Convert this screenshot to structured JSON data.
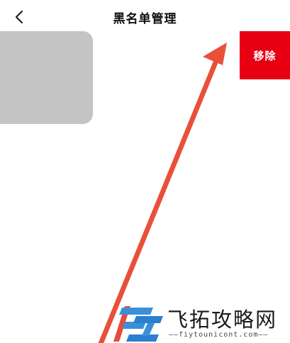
{
  "header": {
    "title": "黑名单管理",
    "back_icon": "chevron-left-icon"
  },
  "blocked_user": {
    "avatar": "avatar-placeholder",
    "remove_label": "移除"
  },
  "annotation": {
    "icon": "arrow-icon",
    "color": "#e8503a"
  },
  "watermark": {
    "name": "飞拓攻略网",
    "domain": "——fiytounicont.com——"
  },
  "colors": {
    "remove_button": "#e60012",
    "avatar_placeholder": "#c4c4c4"
  }
}
